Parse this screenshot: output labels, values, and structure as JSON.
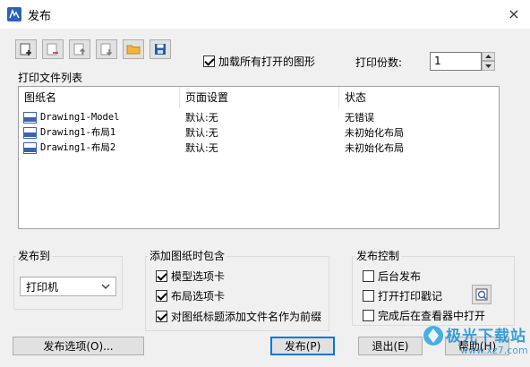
{
  "window": {
    "title": "发布",
    "close": "×"
  },
  "toolbar": {
    "icons": [
      "add-sheets-icon",
      "remove-sheets-icon",
      "move-up-icon",
      "move-down-icon",
      "open-folder-icon",
      "save-icon"
    ],
    "load_all_label": "加载所有打开的图形",
    "load_all_checked": true,
    "copies_label": "打印份数:",
    "copies_value": "1"
  },
  "list": {
    "section_label": "打印文件列表",
    "columns": [
      "图纸名",
      "页面设置",
      "状态"
    ],
    "rows": [
      {
        "name": "Drawing1-Model",
        "setup": "默认:无",
        "status": "无错误"
      },
      {
        "name": "Drawing1-布局1",
        "setup": "默认:无",
        "status": "未初始化布局"
      },
      {
        "name": "Drawing1-布局2",
        "setup": "默认:无",
        "status": "未初始化布局"
      }
    ]
  },
  "publish_to": {
    "label": "发布到",
    "selected": "打印机"
  },
  "include": {
    "label": "添加图纸时包含",
    "options": [
      {
        "label": "模型选项卡",
        "checked": true
      },
      {
        "label": "布局选项卡",
        "checked": true
      },
      {
        "label": "对图纸标题添加文件名作为前缀",
        "checked": true
      }
    ]
  },
  "control": {
    "label": "发布控制",
    "options": [
      {
        "label": "后台发布",
        "checked": false
      },
      {
        "label": "打开打印戳记",
        "checked": false
      },
      {
        "label": "完成后在查看器中打开",
        "checked": false
      }
    ]
  },
  "buttons": {
    "options": "发布选项(O)...",
    "publish": "发布(P)",
    "exit": "退出(E)",
    "help": "帮助(H)"
  },
  "watermark": {
    "text": "极光下载站",
    "url": "www.xz7.com"
  },
  "colors": {
    "accent": "#0078d7",
    "folder": "#f2b43c",
    "save": "#1f5fa8"
  }
}
